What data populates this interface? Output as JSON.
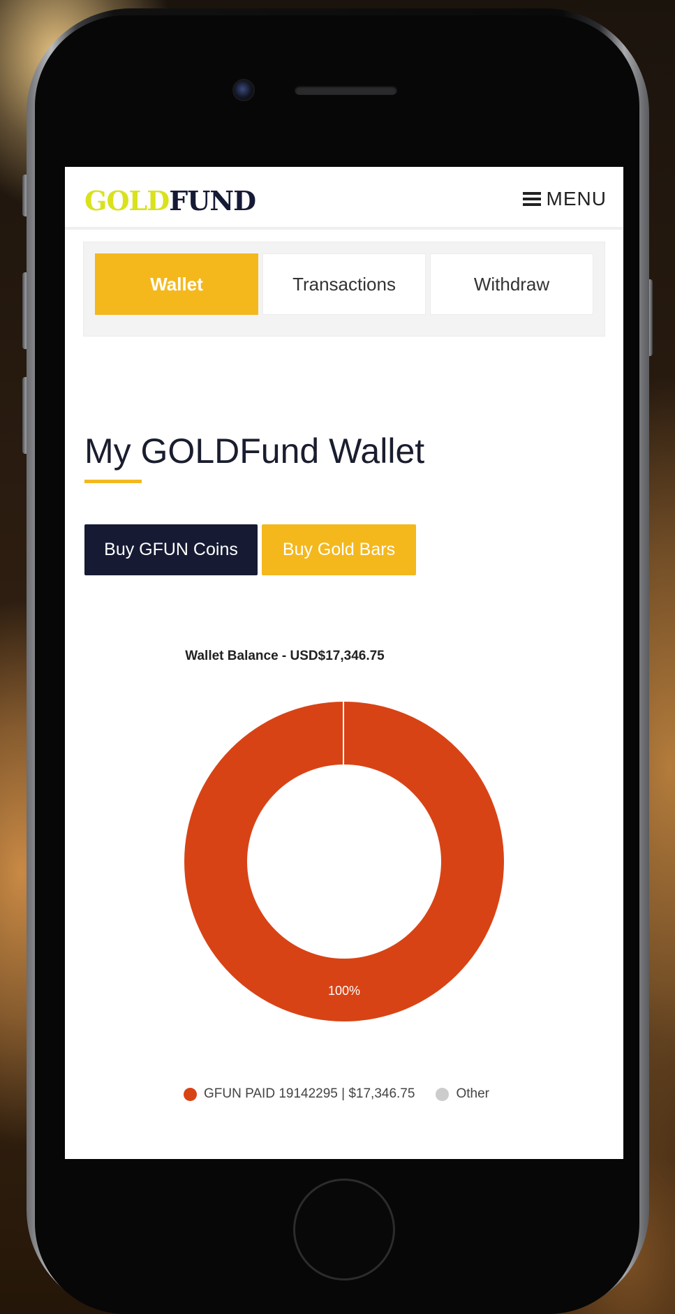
{
  "brand": {
    "logo_gold": "GOLD",
    "logo_fund": "FUND"
  },
  "header": {
    "menu_label": "MENU"
  },
  "tabs": [
    {
      "label": "Wallet",
      "active": true
    },
    {
      "label": "Transactions",
      "active": false
    },
    {
      "label": "Withdraw",
      "active": false
    }
  ],
  "page": {
    "title": "My GOLDFund Wallet"
  },
  "actions": {
    "buy_coins": "Buy GFUN Coins",
    "buy_bars": "Buy Gold Bars"
  },
  "colors": {
    "accent": "#f4b81d",
    "navy": "#161b33",
    "series_main": "#d84315",
    "series_other": "#cccccc"
  },
  "chart_data": {
    "type": "pie",
    "title": "Wallet Balance - USD$17,346.75",
    "donut": true,
    "slices": [
      {
        "name": "GFUN PAID 19142295 | $17,346.75",
        "value": 100,
        "label": "100%",
        "color": "#d84315"
      },
      {
        "name": "Other",
        "value": 0,
        "label": "",
        "color": "#cccccc"
      }
    ],
    "legend_position": "bottom"
  }
}
